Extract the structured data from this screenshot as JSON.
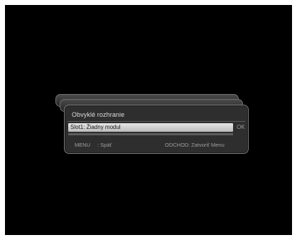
{
  "dialog": {
    "title": "Obvyklé rozhranie",
    "slot_label": "Slot1: Žiadny modul",
    "slot_action": "OK"
  },
  "footer": {
    "menu_key": "MENU",
    "menu_action": ": Späť",
    "exit_key": "ODCHOD",
    "exit_action": ": Zatvoriť Menu"
  },
  "colors": {
    "background": "#000000",
    "selection": "#d4d4d4",
    "text": "#dcdcdc",
    "hint_text": "#9e9e9e"
  }
}
